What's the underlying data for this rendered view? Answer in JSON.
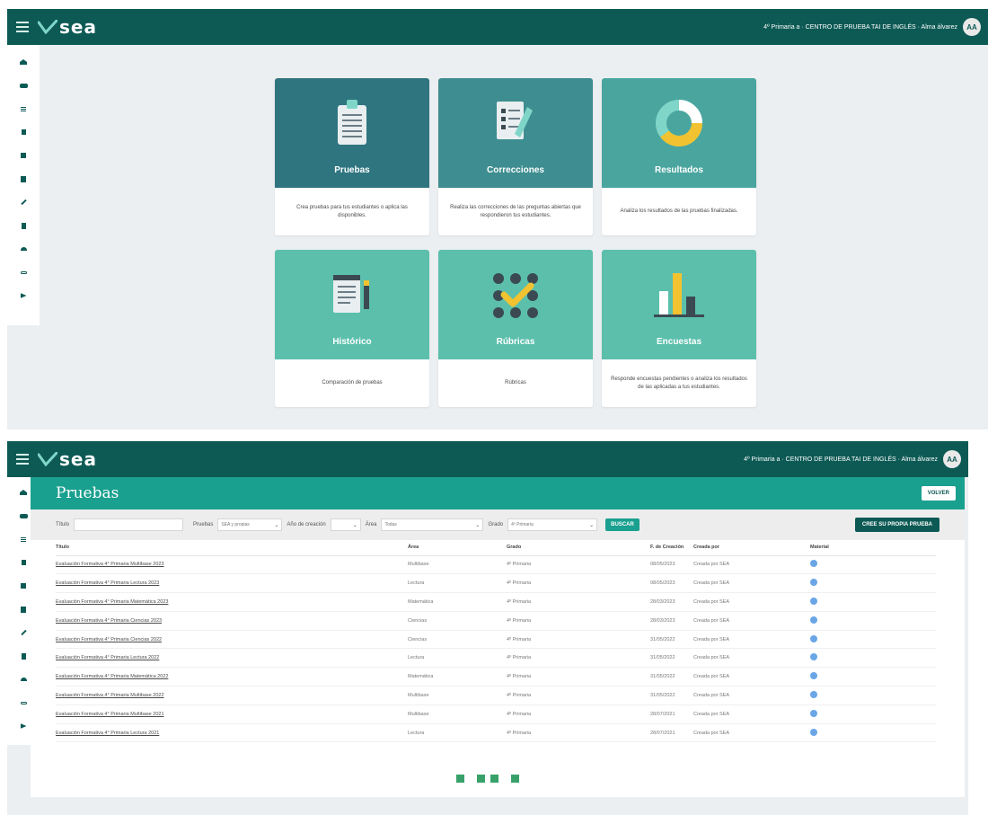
{
  "app": {
    "logo_text": "sea",
    "user_info_1": "4º Primaria a · CENTRO DE PRUEBA TAI DE INGLÉS · Alma álvarez",
    "user_info_2": "4º Primaria a · CENTRO DE PRUEBA TAI DE INGLÉS · Alma álvarez",
    "avatar_initials": "AA",
    "sidebar_icons": [
      "home-icon",
      "car-icon",
      "list-icon",
      "book-icon",
      "layers-icon",
      "document-icon",
      "pencil-icon",
      "clipboard-icon",
      "headset-icon",
      "link-icon",
      "send-icon"
    ],
    "colors": {
      "topbar": "#0d5a55",
      "accent": "#1aa08f",
      "card_dark": "#2e7580",
      "card_mid": "#3e8d90",
      "card_light": "#5bbfac"
    }
  },
  "dashboard": {
    "cards": [
      {
        "title": "Pruebas",
        "desc": "Crea pruebas para tus estudiantes o aplica las disponibles.",
        "icon": "clipboard-list-icon"
      },
      {
        "title": "Correcciones",
        "desc": "Realiza las correcciones de las preguntas abiertas que respondieron tus estudiantes.",
        "icon": "checklist-icon"
      },
      {
        "title": "Resultados",
        "desc": "Analiza los resultados de las pruebas finalizadas.",
        "icon": "donut-chart-icon"
      },
      {
        "title": "Histórico",
        "desc": "Comparación de pruebas",
        "icon": "history-document-icon"
      },
      {
        "title": "Rúbricas",
        "desc": "Rúbricas",
        "icon": "rubric-check-icon"
      },
      {
        "title": "Encuestas",
        "desc": "Responde encuestas pendientes o analiza los resultados de las aplicadas a tus estudiantes.",
        "icon": "bar-chart-icon"
      }
    ]
  },
  "pruebas": {
    "page_title": "Pruebas",
    "volver_label": "VOLVER",
    "filters": {
      "titulo_label": "Título",
      "titulo_value": "",
      "pruebas_label": "Pruebas",
      "pruebas_value": "SEA y propias",
      "anio_label": "Año de creación",
      "anio_value": "",
      "area_label": "Área",
      "area_value": "Todas",
      "grado_label": "Grado",
      "grado_value": "4º Primaria",
      "buscar_label": "BUSCAR",
      "crear_label": "CREE SU PROPIA PRUEBA"
    },
    "columns": [
      "Título",
      "Área",
      "Grado",
      "F. de Creación",
      "Creada por",
      "Material"
    ],
    "rows": [
      {
        "titulo": "Evaluación Formativa 4° Primaria Multibase 2023",
        "area": "Multibase",
        "grado": "4º Primaria",
        "fecha": "08/05/2023",
        "creada": "Creada por SEA"
      },
      {
        "titulo": "Evaluación Formativa 4° Primaria Lectura 2023",
        "area": "Lectura",
        "grado": "4º Primaria",
        "fecha": "08/05/2023",
        "creada": "Creada por SEA"
      },
      {
        "titulo": "Evaluación Formativa 4° Primaria Matemática 2023",
        "area": "Matemática",
        "grado": "4º Primaria",
        "fecha": "28/03/2023",
        "creada": "Creada por SEA"
      },
      {
        "titulo": "Evaluación Formativa 4° Primaria Ciencias 2023",
        "area": "Ciencias",
        "grado": "4º Primaria",
        "fecha": "28/03/2023",
        "creada": "Creada por SEA"
      },
      {
        "titulo": "Evaluación Formativa 4° Primaria Ciencias 2022",
        "area": "Ciencias",
        "grado": "4º Primaria",
        "fecha": "31/05/2022",
        "creada": "Creada por SEA"
      },
      {
        "titulo": "Evaluación Formativa 4° Primaria Lectura 2022",
        "area": "Lectura",
        "grado": "4º Primaria",
        "fecha": "31/05/2022",
        "creada": "Creada por SEA"
      },
      {
        "titulo": "Evaluación Formativa 4° Primaria Matemática 2022",
        "area": "Matemática",
        "grado": "4º Primaria",
        "fecha": "31/05/2022",
        "creada": "Creada por SEA"
      },
      {
        "titulo": "Evaluación Formativa 4° Primaria Multibase 2022",
        "area": "Multibase",
        "grado": "4º Primaria",
        "fecha": "31/05/2022",
        "creada": "Creada por SEA"
      },
      {
        "titulo": "Evaluación Formativa 4° Primaria Multibase 2021",
        "area": "Multibase",
        "grado": "4º Primaria",
        "fecha": "28/07/2021",
        "creada": "Creada por SEA"
      },
      {
        "titulo": "Evaluación Formativa 4° Primaria Lectura 2021",
        "area": "Lectura",
        "grado": "4º Primaria",
        "fecha": "28/07/2021",
        "creada": "Creada por SEA"
      }
    ]
  }
}
